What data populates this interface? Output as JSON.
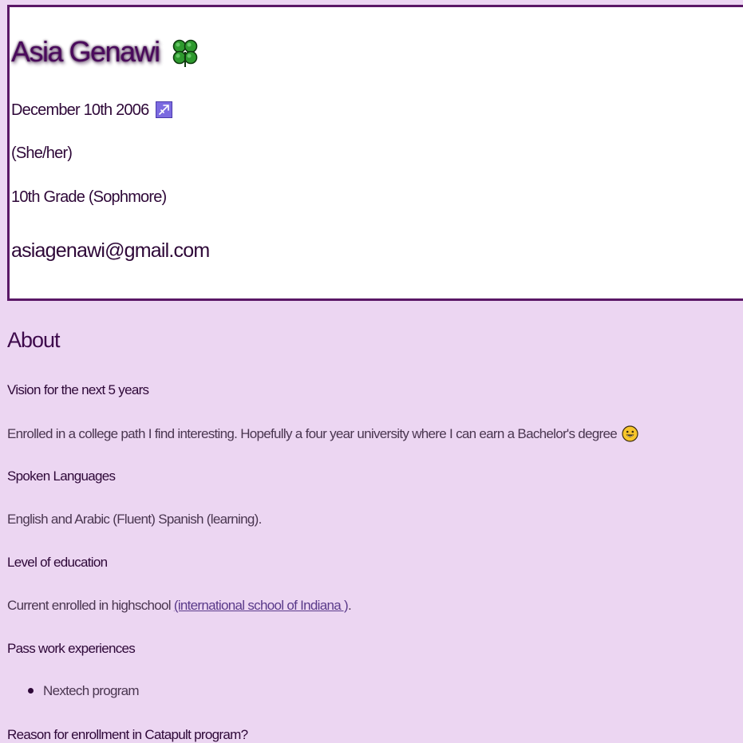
{
  "profile": {
    "name": "Asia Genawi",
    "name_icon": "four-leaf-clover-icon",
    "birthday": "December 10th 2006",
    "zodiac_icon": "sagittarius-icon",
    "pronouns": "(She/her)",
    "grade": "10th Grade (Sophmore)",
    "email": "asiagenawi@gmail.com"
  },
  "about": {
    "title": "About",
    "vision": {
      "question": "Vision for the next 5 years",
      "answer": "Enrolled in a college path I find interesting. Hopefully a four year university where I can earn a Bachelor's degree",
      "icon": "smiley-face-icon"
    },
    "languages": {
      "question": "Spoken Languages",
      "answer": "English and Arabic (Fluent) Spanish (learning)."
    },
    "education": {
      "question": "Level of education",
      "answer_prefix": "Current enrolled in highschool",
      "link_text": "(international school of Indiana )",
      "answer_suffix": "."
    },
    "work": {
      "question": "Pass work experiences",
      "items": [
        "Nextech program"
      ]
    },
    "reason": {
      "question": "Reason for enrollment in Catapult program?"
    }
  },
  "colors": {
    "page_background": "#ecd6f2",
    "card_border": "#5a1766",
    "heading_text": "#3e0a4c",
    "body_text": "#4a3650",
    "link": "#5a3a8a",
    "zodiac_tile": "#7b6ae0",
    "clover_green": "#2e9a2e"
  }
}
